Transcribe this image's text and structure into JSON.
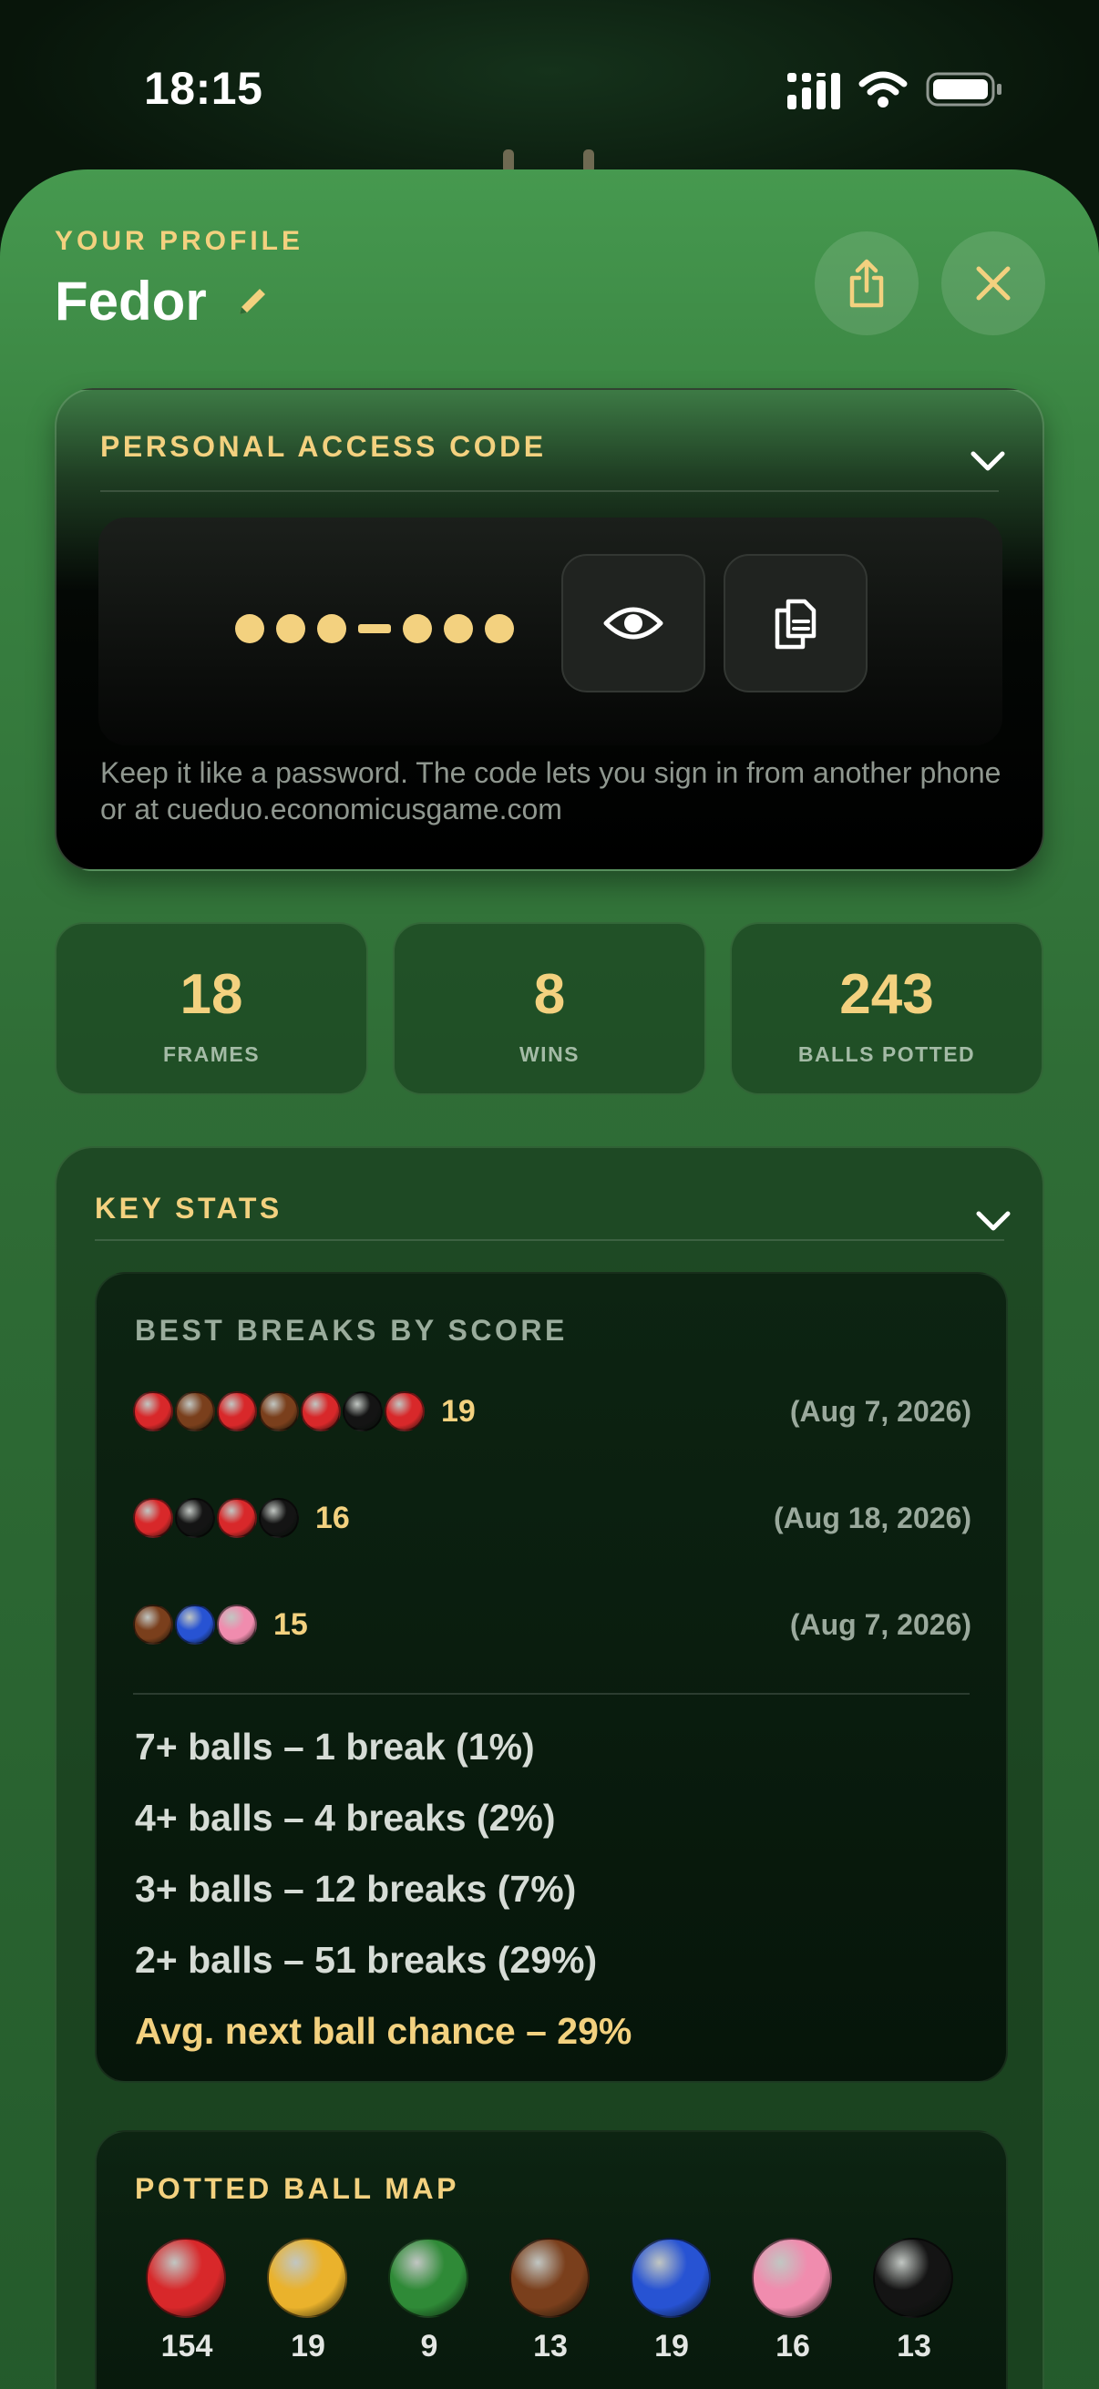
{
  "status_bar": {
    "time": "18:15"
  },
  "profile": {
    "eyebrow": "YOUR PROFILE",
    "name": "Fedor"
  },
  "access_code": {
    "title": "PERSONAL ACCESS CODE",
    "note": "Keep it like a password. The code lets you sign in from another phone or at cueduo.economicusgame.com"
  },
  "stats": [
    {
      "value": "18",
      "label": "FRAMES"
    },
    {
      "value": "8",
      "label": "WINS"
    },
    {
      "value": "243",
      "label": "BALLS POTTED"
    }
  ],
  "key_stats": {
    "title": "KEY STATS",
    "best_breaks_title": "BEST BREAKS BY SCORE",
    "breaks": [
      {
        "balls": [
          "red",
          "brown",
          "red",
          "brown",
          "red",
          "black",
          "red"
        ],
        "score": "19",
        "date": "(Aug 7, 2026)"
      },
      {
        "balls": [
          "red",
          "black",
          "red",
          "black"
        ],
        "score": "16",
        "date": "(Aug 18, 2026)"
      },
      {
        "balls": [
          "brown",
          "blue",
          "pink"
        ],
        "score": "15",
        "date": "(Aug 7, 2026)"
      }
    ],
    "summary": [
      "7+ balls – 1 break (1%)",
      "4+ balls – 4 breaks (2%)",
      "3+ balls – 12 breaks (7%)",
      "2+ balls – 51 breaks (29%)"
    ],
    "avg_next_ball": "Avg. next ball chance – 29%"
  },
  "potted_map": {
    "title": "POTTED BALL MAP",
    "balls": [
      {
        "color": "red",
        "count": "154"
      },
      {
        "color": "yellow",
        "count": "19"
      },
      {
        "color": "green",
        "count": "9"
      },
      {
        "color": "brown",
        "count": "13"
      },
      {
        "color": "blue",
        "count": "19"
      },
      {
        "color": "pink",
        "count": "16"
      },
      {
        "color": "black",
        "count": "13"
      }
    ]
  },
  "colors": {
    "accent_gold": "#f3d17f",
    "felt_green": "#3a8442",
    "ball_red": "#d8282a",
    "ball_yellow": "#eab22c",
    "ball_green": "#2f8a37",
    "ball_brown": "#7a3f1c",
    "ball_blue": "#2753d3",
    "ball_pink": "#f08cae",
    "ball_black": "#141414"
  }
}
